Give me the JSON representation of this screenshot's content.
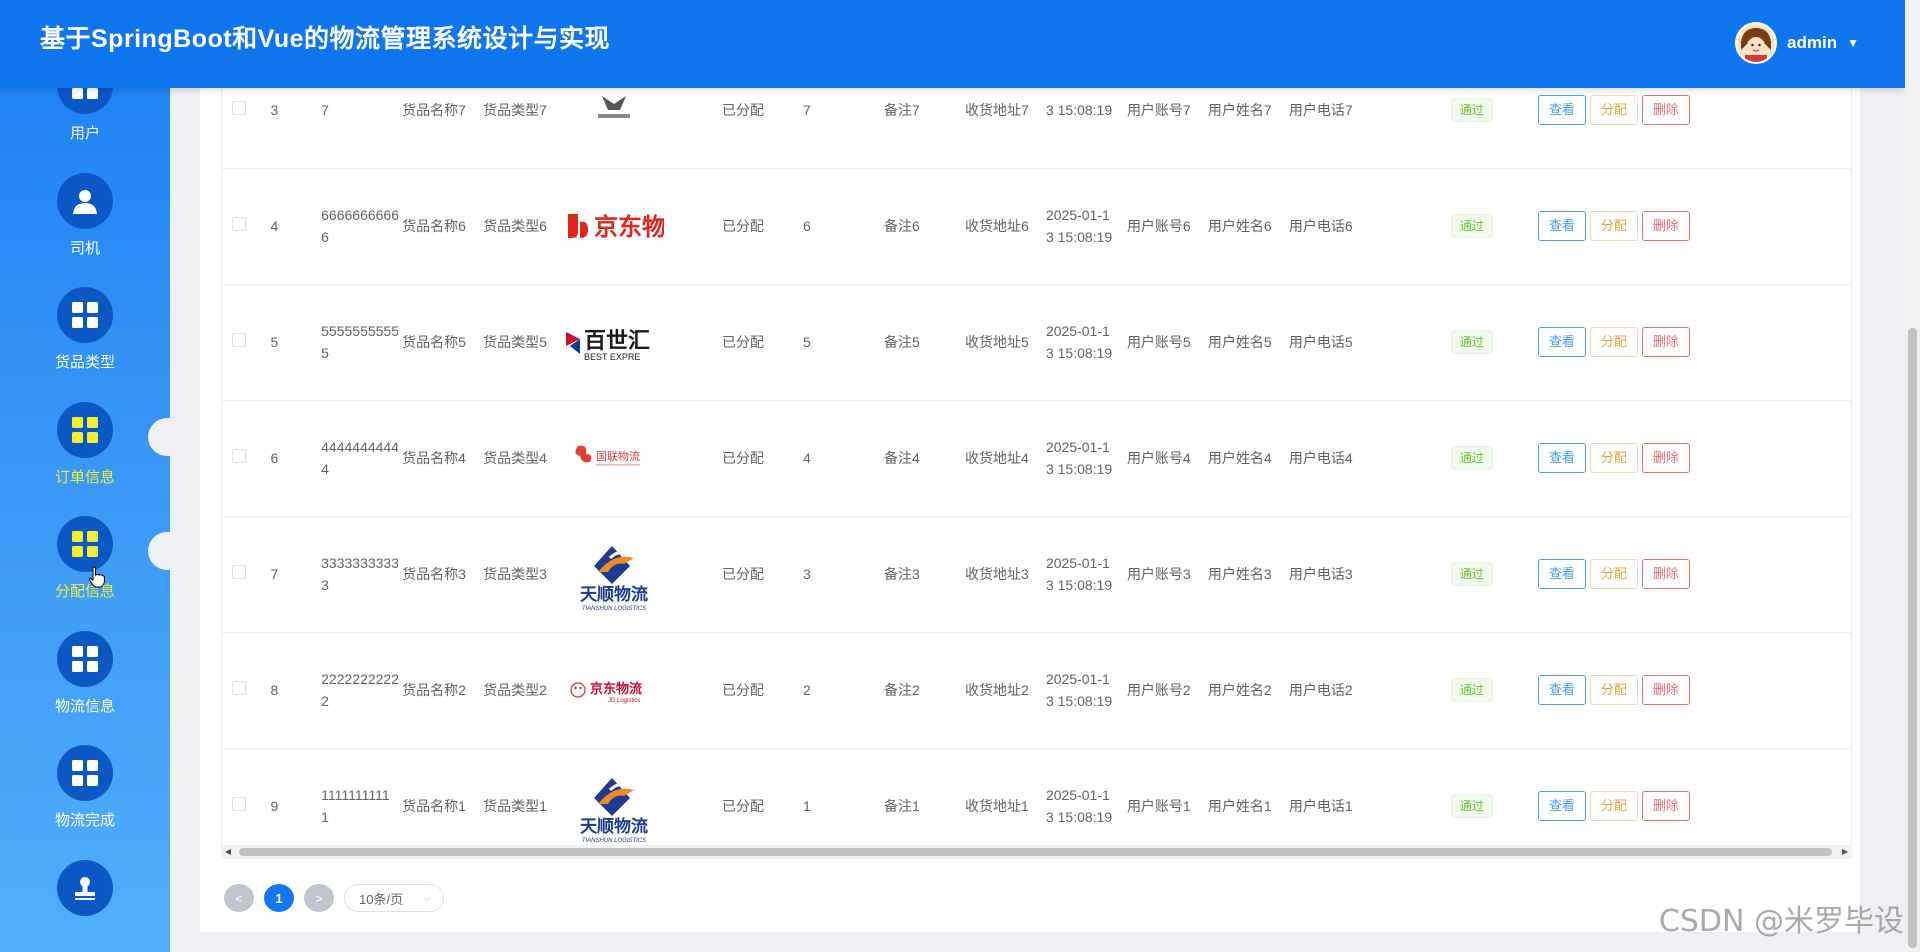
{
  "header": {
    "title": "基于SpringBoot和Vue的物流管理系统设计与实现",
    "username": "admin"
  },
  "sidebar": {
    "items": [
      {
        "label": "用户",
        "icon": "grid-icon",
        "active": false
      },
      {
        "label": "司机",
        "icon": "person-icon",
        "active": false
      },
      {
        "label": "货品类型",
        "icon": "grid-icon",
        "active": false
      },
      {
        "label": "订单信息",
        "icon": "grid-icon",
        "active": true
      },
      {
        "label": "分配信息",
        "icon": "grid-icon",
        "active": true
      },
      {
        "label": "物流信息",
        "icon": "grid-icon",
        "active": false
      },
      {
        "label": "物流完成",
        "icon": "grid-icon",
        "active": false
      },
      {
        "label": "",
        "icon": "stamp-icon",
        "active": false
      }
    ]
  },
  "table": {
    "rows": [
      {
        "index": "3",
        "number": "7",
        "goods_name": "货品名称7",
        "goods_type": "货品类型7",
        "logo": "logo-generic",
        "status": "已分配",
        "qty": "7",
        "remark": "备注7",
        "address": "收货地址7",
        "time": "3 15:08:19",
        "account": "用户账号7",
        "user_name": "用户姓名7",
        "phone": "用户电话7",
        "audit": "通过"
      },
      {
        "index": "4",
        "number": "6666666666",
        "goods_name": "货品名称6",
        "goods_type": "货品类型6",
        "logo": "logo-jd-red",
        "logo_text": "京东物",
        "status": "已分配",
        "qty": "6",
        "remark": "备注6",
        "address": "收货地址6",
        "time": "2025-01-1",
        "account": "用户账号6",
        "user_name": "用户姓名6",
        "phone": "用户电话6",
        "audit": "通过"
      },
      {
        "index": "5",
        "number": "5555555555",
        "goods_name": "货品名称5",
        "goods_type": "货品类型5",
        "logo": "logo-best",
        "logo_text": "百世汇",
        "logo_sub": "BEST EXPRE",
        "status": "已分配",
        "qty": "5",
        "remark": "备注5",
        "address": "收货地址5",
        "time": "2025-01-1",
        "account": "用户账号5",
        "user_name": "用户姓名5",
        "phone": "用户电话5",
        "audit": "通过"
      },
      {
        "index": "6",
        "number": "4444444444",
        "goods_name": "货品名称4",
        "goods_type": "货品类型4",
        "logo": "logo-guolian",
        "logo_text": "国联物流",
        "status": "已分配",
        "qty": "4",
        "remark": "备注4",
        "address": "收货地址4",
        "time": "2025-01-1",
        "account": "用户账号4",
        "user_name": "用户姓名4",
        "phone": "用户电话4",
        "audit": "通过"
      },
      {
        "index": "7",
        "number": "3333333333",
        "goods_name": "货品名称3",
        "goods_type": "货品类型3",
        "logo": "logo-tianshun",
        "logo_text": "天顺物流",
        "logo_sub": "TIANSHUN LOGISTICS",
        "status": "已分配",
        "qty": "3",
        "remark": "备注3",
        "address": "收货地址3",
        "time": "2025-01-1",
        "account": "用户账号3",
        "user_name": "用户姓名3",
        "phone": "用户电话3",
        "audit": "通过"
      },
      {
        "index": "8",
        "number": "2222222222",
        "goods_name": "货品名称2",
        "goods_type": "货品类型2",
        "logo": "logo-jd-small",
        "logo_text": "京东物流",
        "logo_sub": "JD Logistics",
        "status": "已分配",
        "qty": "2",
        "remark": "备注2",
        "address": "收货地址2",
        "time": "2025-01-1",
        "account": "用户账号2",
        "user_name": "用户姓名2",
        "phone": "用户电话2",
        "audit": "通过"
      },
      {
        "index": "9",
        "number": "1111111111",
        "goods_name": "货品名称1",
        "goods_type": "货品类型1",
        "logo": "logo-tianshun",
        "logo_text": "天顺物流",
        "logo_sub": "TIANSHUN LOGISTICS",
        "status": "已分配",
        "qty": "1",
        "remark": "备注1",
        "address": "收货地址1",
        "time": "2025-01-1",
        "account": "用户账号1",
        "user_name": "用户姓名1",
        "phone": "用户电话1",
        "audit": "通过"
      }
    ],
    "number_suffix": [
      "7",
      "6",
      "5",
      "4",
      "3",
      "2",
      "1"
    ],
    "time_second_line": "3 15:08:19",
    "actions": {
      "view": "查看",
      "assign": "分配",
      "delete": "删除"
    }
  },
  "pagination": {
    "prev": "<",
    "page": "1",
    "next": ">",
    "page_size": "10条/页"
  },
  "watermark": "CSDN @米罗毕设",
  "colors": {
    "header": "#0f76ee",
    "active_nav": "#f2ee33",
    "primary": "#1678f0"
  }
}
